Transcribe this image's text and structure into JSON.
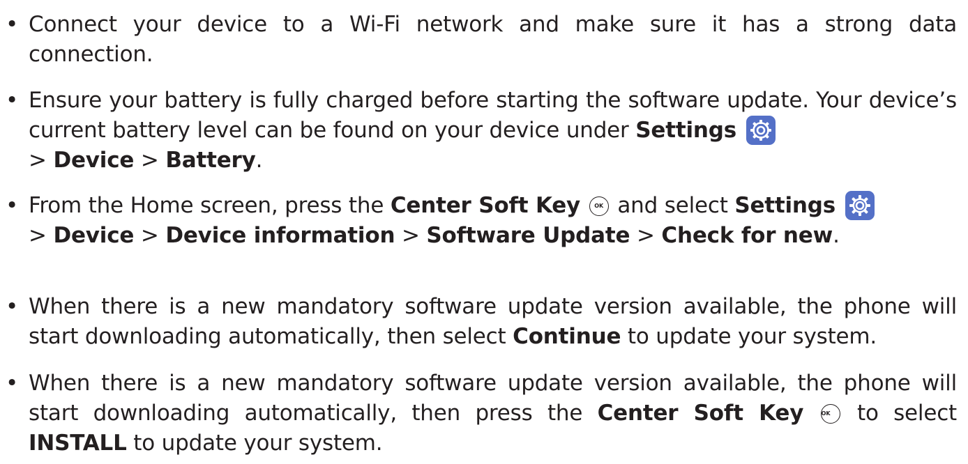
{
  "items": [
    {
      "text_a": "Connect your device to a Wi-Fi network and make sure it has a strong data connection."
    },
    {
      "text_a": "Ensure your battery is fully charged before starting the software update. Your device’s current battery level can be found on your device under ",
      "b_settings": "Settings",
      "sep1": " > ",
      "b_device": "Device",
      "sep2": " > ",
      "b_battery": "Battery",
      "end": "."
    },
    {
      "text_a": "From the Home screen, press the ",
      "b_center": "Center Soft Key",
      "text_b": " and select ",
      "b_settings": "Settings",
      "sep1": " > ",
      "b_device": "Device",
      "sep2": " > ",
      "b_devinfo": "Device information",
      "sep3": " > ",
      "b_swupdate": "Software Update",
      "sep4": " > ",
      "b_check": "Check for new",
      "end": "."
    },
    {
      "text_a": "When there is a new mandatory software update version available, the phone will start downloading automatically, then select ",
      "b_continue": "Continue",
      "text_b": " to update your system."
    },
    {
      "text_a": "When there is a new mandatory software update version available, the phone will start downloading automatically, then press the ",
      "b_center": "Center Soft Key",
      "text_b": " to select ",
      "b_install": "INSTALL",
      "text_c": " to update your system."
    }
  ],
  "icons": {
    "settings": "settings-gear-icon",
    "softkey": "ok-key-icon",
    "softkey_label": "OK"
  },
  "colors": {
    "text": "#231f20",
    "settings_icon_bg": "#5470c7"
  }
}
